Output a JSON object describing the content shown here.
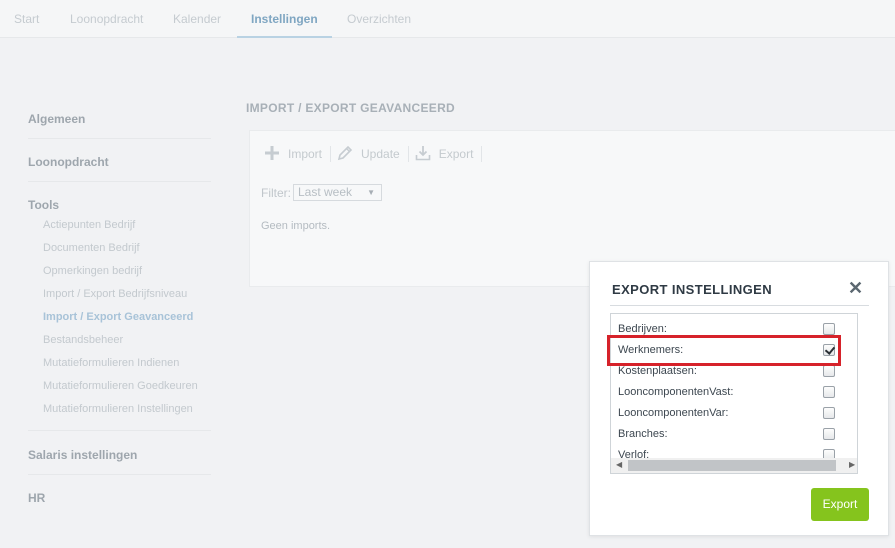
{
  "topnav": {
    "tabs": [
      {
        "label": "Start"
      },
      {
        "label": "Loonopdracht"
      },
      {
        "label": "Kalender"
      },
      {
        "label": "Instellingen"
      },
      {
        "label": "Overzichten"
      }
    ],
    "active_tab": "Instellingen"
  },
  "sidebar": {
    "sections": [
      {
        "label": "Algemeen"
      },
      {
        "label": "Loonopdracht"
      },
      {
        "label": "Tools"
      },
      {
        "label": "Salaris instellingen"
      },
      {
        "label": "HR"
      }
    ],
    "tools_items": [
      {
        "label": "Actiepunten Bedrijf"
      },
      {
        "label": "Documenten Bedrijf"
      },
      {
        "label": "Opmerkingen bedrijf"
      },
      {
        "label": "Import / Export Bedrijfsniveau"
      },
      {
        "label": "Import / Export Geavanceerd"
      },
      {
        "label": "Bestandsbeheer"
      },
      {
        "label": "Mutatieformulieren Indienen"
      },
      {
        "label": "Mutatieformulieren Goedkeuren"
      },
      {
        "label": "Mutatieformulieren Instellingen"
      }
    ],
    "active_item": "Import / Export Geavanceerd"
  },
  "main": {
    "heading": "IMPORT / EXPORT GEAVANCEERD",
    "toolbar": {
      "import_label": "Import",
      "update_label": "Update",
      "export_label": "Export"
    },
    "filter": {
      "label": "Filter:",
      "selected": "Last week"
    },
    "empty_text": "Geen imports."
  },
  "dialog": {
    "title": "EXPORT INSTELLINGEN",
    "close_glyph": "✕",
    "items": [
      {
        "label": "Bedrijven:",
        "checked": false
      },
      {
        "label": "Werknemers:",
        "checked": true
      },
      {
        "label": "Kostenplaatsen:",
        "checked": false
      },
      {
        "label": "LooncomponentenVast:",
        "checked": false
      },
      {
        "label": "LooncomponentenVar:",
        "checked": false
      },
      {
        "label": "Branches:",
        "checked": false
      },
      {
        "label": "Verlof:",
        "checked": false
      }
    ],
    "export_button_label": "Export",
    "highlight_color": "#d6222a",
    "button_color": "#85c41d"
  }
}
